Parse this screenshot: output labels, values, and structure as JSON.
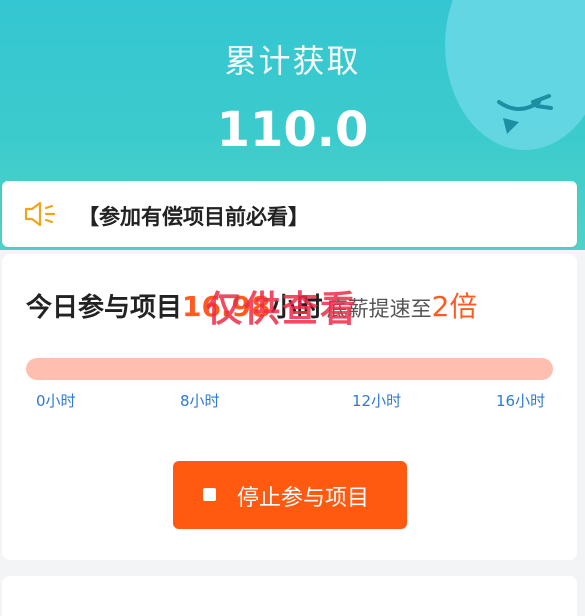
{
  "header": {
    "title": "累计获取",
    "amount": "110.0"
  },
  "notice": {
    "icon": "speaker-icon",
    "text": "【参加有偿项目前必看】"
  },
  "status": {
    "prefix": "今日参与项目",
    "hours": "16.98",
    "unit": "小时",
    "sub": "底薪提速至",
    "multiplier": "2倍"
  },
  "watermark": "仅供查看",
  "progress": {
    "fraction": 1.0,
    "ticks": [
      "0小时",
      "8小时",
      "12小时",
      "16小时"
    ]
  },
  "stop_button": {
    "label": "停止参与项目",
    "icon": "stop-icon"
  },
  "colors": {
    "accent_orange": "#ff5a0f",
    "header_teal": "#3ccbcc",
    "watermark_red": "#ee2a46",
    "tick_blue": "#2f7ad7"
  }
}
